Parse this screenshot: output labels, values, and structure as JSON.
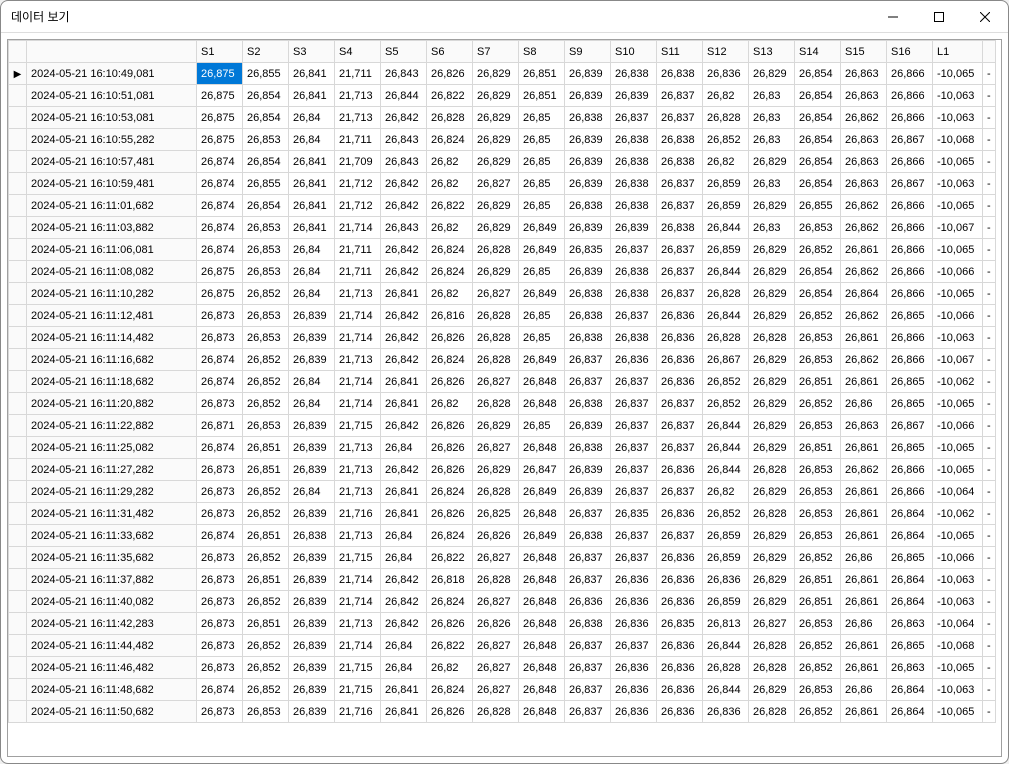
{
  "window": {
    "title": "데이터 보기"
  },
  "columns": [
    "S1",
    "S2",
    "S3",
    "S4",
    "S5",
    "S6",
    "S7",
    "S8",
    "S9",
    "S10",
    "S11",
    "S12",
    "S13",
    "S14",
    "S15",
    "S16",
    "L1"
  ],
  "selected": {
    "row": 0,
    "col": 0
  },
  "chart_data": {
    "type": "table",
    "columns": [
      "timestamp",
      "S1",
      "S2",
      "S3",
      "S4",
      "S5",
      "S6",
      "S7",
      "S8",
      "S9",
      "S10",
      "S11",
      "S12",
      "S13",
      "S14",
      "S15",
      "S16",
      "L1"
    ],
    "rows": [
      [
        "2024-05-21 16:10:49,081",
        "26,875",
        "26,855",
        "26,841",
        "21,711",
        "26,843",
        "26,826",
        "26,829",
        "26,851",
        "26,839",
        "26,838",
        "26,838",
        "26,836",
        "26,829",
        "26,854",
        "26,863",
        "26,866",
        "-10,065"
      ],
      [
        "2024-05-21 16:10:51,081",
        "26,875",
        "26,854",
        "26,841",
        "21,713",
        "26,844",
        "26,822",
        "26,829",
        "26,851",
        "26,839",
        "26,839",
        "26,837",
        "26,82",
        "26,83",
        "26,854",
        "26,863",
        "26,866",
        "-10,063"
      ],
      [
        "2024-05-21 16:10:53,081",
        "26,875",
        "26,854",
        "26,84",
        "21,713",
        "26,842",
        "26,828",
        "26,829",
        "26,85",
        "26,838",
        "26,837",
        "26,837",
        "26,828",
        "26,83",
        "26,854",
        "26,862",
        "26,866",
        "-10,063"
      ],
      [
        "2024-05-21 16:10:55,282",
        "26,875",
        "26,853",
        "26,84",
        "21,711",
        "26,843",
        "26,824",
        "26,829",
        "26,85",
        "26,839",
        "26,838",
        "26,838",
        "26,852",
        "26,83",
        "26,854",
        "26,863",
        "26,867",
        "-10,068"
      ],
      [
        "2024-05-21 16:10:57,481",
        "26,874",
        "26,854",
        "26,841",
        "21,709",
        "26,843",
        "26,82",
        "26,829",
        "26,85",
        "26,839",
        "26,838",
        "26,838",
        "26,82",
        "26,829",
        "26,854",
        "26,863",
        "26,866",
        "-10,065"
      ],
      [
        "2024-05-21 16:10:59,481",
        "26,874",
        "26,855",
        "26,841",
        "21,712",
        "26,842",
        "26,82",
        "26,827",
        "26,85",
        "26,839",
        "26,838",
        "26,837",
        "26,859",
        "26,83",
        "26,854",
        "26,863",
        "26,867",
        "-10,063"
      ],
      [
        "2024-05-21 16:11:01,682",
        "26,874",
        "26,854",
        "26,841",
        "21,712",
        "26,842",
        "26,822",
        "26,829",
        "26,85",
        "26,838",
        "26,838",
        "26,837",
        "26,859",
        "26,829",
        "26,855",
        "26,862",
        "26,866",
        "-10,065"
      ],
      [
        "2024-05-21 16:11:03,882",
        "26,874",
        "26,853",
        "26,841",
        "21,714",
        "26,843",
        "26,82",
        "26,829",
        "26,849",
        "26,839",
        "26,839",
        "26,838",
        "26,844",
        "26,83",
        "26,853",
        "26,862",
        "26,866",
        "-10,067"
      ],
      [
        "2024-05-21 16:11:06,081",
        "26,874",
        "26,853",
        "26,84",
        "21,711",
        "26,842",
        "26,824",
        "26,828",
        "26,849",
        "26,835",
        "26,837",
        "26,837",
        "26,859",
        "26,829",
        "26,852",
        "26,861",
        "26,866",
        "-10,065"
      ],
      [
        "2024-05-21 16:11:08,082",
        "26,875",
        "26,853",
        "26,84",
        "21,711",
        "26,842",
        "26,824",
        "26,829",
        "26,85",
        "26,839",
        "26,838",
        "26,837",
        "26,844",
        "26,829",
        "26,854",
        "26,862",
        "26,866",
        "-10,066"
      ],
      [
        "2024-05-21 16:11:10,282",
        "26,875",
        "26,852",
        "26,84",
        "21,713",
        "26,841",
        "26,82",
        "26,827",
        "26,849",
        "26,838",
        "26,838",
        "26,837",
        "26,828",
        "26,829",
        "26,854",
        "26,864",
        "26,866",
        "-10,065"
      ],
      [
        "2024-05-21 16:11:12,481",
        "26,873",
        "26,853",
        "26,839",
        "21,714",
        "26,842",
        "26,816",
        "26,828",
        "26,85",
        "26,838",
        "26,837",
        "26,836",
        "26,844",
        "26,829",
        "26,852",
        "26,862",
        "26,865",
        "-10,066"
      ],
      [
        "2024-05-21 16:11:14,482",
        "26,873",
        "26,853",
        "26,839",
        "21,714",
        "26,842",
        "26,826",
        "26,828",
        "26,85",
        "26,838",
        "26,838",
        "26,836",
        "26,828",
        "26,828",
        "26,853",
        "26,861",
        "26,866",
        "-10,063"
      ],
      [
        "2024-05-21 16:11:16,682",
        "26,874",
        "26,852",
        "26,839",
        "21,713",
        "26,842",
        "26,824",
        "26,828",
        "26,849",
        "26,837",
        "26,836",
        "26,836",
        "26,867",
        "26,829",
        "26,853",
        "26,862",
        "26,866",
        "-10,067"
      ],
      [
        "2024-05-21 16:11:18,682",
        "26,874",
        "26,852",
        "26,84",
        "21,714",
        "26,841",
        "26,826",
        "26,827",
        "26,848",
        "26,837",
        "26,837",
        "26,836",
        "26,852",
        "26,829",
        "26,851",
        "26,861",
        "26,865",
        "-10,062"
      ],
      [
        "2024-05-21 16:11:20,882",
        "26,873",
        "26,852",
        "26,84",
        "21,714",
        "26,841",
        "26,82",
        "26,828",
        "26,848",
        "26,838",
        "26,837",
        "26,837",
        "26,852",
        "26,829",
        "26,852",
        "26,86",
        "26,865",
        "-10,065"
      ],
      [
        "2024-05-21 16:11:22,882",
        "26,871",
        "26,853",
        "26,839",
        "21,715",
        "26,842",
        "26,826",
        "26,829",
        "26,85",
        "26,839",
        "26,837",
        "26,837",
        "26,844",
        "26,829",
        "26,853",
        "26,863",
        "26,867",
        "-10,066"
      ],
      [
        "2024-05-21 16:11:25,082",
        "26,874",
        "26,851",
        "26,839",
        "21,713",
        "26,84",
        "26,826",
        "26,827",
        "26,848",
        "26,838",
        "26,837",
        "26,837",
        "26,844",
        "26,829",
        "26,851",
        "26,861",
        "26,865",
        "-10,065"
      ],
      [
        "2024-05-21 16:11:27,282",
        "26,873",
        "26,851",
        "26,839",
        "21,713",
        "26,842",
        "26,826",
        "26,829",
        "26,847",
        "26,839",
        "26,837",
        "26,836",
        "26,844",
        "26,828",
        "26,853",
        "26,862",
        "26,866",
        "-10,065"
      ],
      [
        "2024-05-21 16:11:29,282",
        "26,873",
        "26,852",
        "26,84",
        "21,713",
        "26,841",
        "26,824",
        "26,828",
        "26,849",
        "26,839",
        "26,837",
        "26,837",
        "26,82",
        "26,829",
        "26,853",
        "26,861",
        "26,866",
        "-10,064"
      ],
      [
        "2024-05-21 16:11:31,482",
        "26,873",
        "26,852",
        "26,839",
        "21,716",
        "26,841",
        "26,826",
        "26,825",
        "26,848",
        "26,837",
        "26,835",
        "26,836",
        "26,852",
        "26,828",
        "26,853",
        "26,861",
        "26,864",
        "-10,062"
      ],
      [
        "2024-05-21 16:11:33,682",
        "26,874",
        "26,851",
        "26,838",
        "21,713",
        "26,84",
        "26,824",
        "26,826",
        "26,849",
        "26,838",
        "26,837",
        "26,837",
        "26,859",
        "26,829",
        "26,853",
        "26,861",
        "26,864",
        "-10,065"
      ],
      [
        "2024-05-21 16:11:35,682",
        "26,873",
        "26,852",
        "26,839",
        "21,715",
        "26,84",
        "26,822",
        "26,827",
        "26,848",
        "26,837",
        "26,837",
        "26,836",
        "26,859",
        "26,829",
        "26,852",
        "26,86",
        "26,865",
        "-10,066"
      ],
      [
        "2024-05-21 16:11:37,882",
        "26,873",
        "26,851",
        "26,839",
        "21,714",
        "26,842",
        "26,818",
        "26,828",
        "26,848",
        "26,837",
        "26,836",
        "26,836",
        "26,836",
        "26,829",
        "26,851",
        "26,861",
        "26,864",
        "-10,063"
      ],
      [
        "2024-05-21 16:11:40,082",
        "26,873",
        "26,852",
        "26,839",
        "21,714",
        "26,842",
        "26,824",
        "26,827",
        "26,848",
        "26,836",
        "26,836",
        "26,836",
        "26,859",
        "26,829",
        "26,851",
        "26,861",
        "26,864",
        "-10,063"
      ],
      [
        "2024-05-21 16:11:42,283",
        "26,873",
        "26,851",
        "26,839",
        "21,713",
        "26,842",
        "26,826",
        "26,826",
        "26,848",
        "26,838",
        "26,836",
        "26,835",
        "26,813",
        "26,827",
        "26,853",
        "26,86",
        "26,863",
        "-10,064"
      ],
      [
        "2024-05-21 16:11:44,482",
        "26,873",
        "26,852",
        "26,839",
        "21,714",
        "26,84",
        "26,822",
        "26,827",
        "26,848",
        "26,837",
        "26,837",
        "26,836",
        "26,844",
        "26,828",
        "26,852",
        "26,861",
        "26,865",
        "-10,068"
      ],
      [
        "2024-05-21 16:11:46,482",
        "26,873",
        "26,852",
        "26,839",
        "21,715",
        "26,84",
        "26,82",
        "26,827",
        "26,848",
        "26,837",
        "26,836",
        "26,836",
        "26,828",
        "26,828",
        "26,852",
        "26,861",
        "26,863",
        "-10,065"
      ],
      [
        "2024-05-21 16:11:48,682",
        "26,874",
        "26,852",
        "26,839",
        "21,715",
        "26,841",
        "26,824",
        "26,827",
        "26,848",
        "26,837",
        "26,836",
        "26,836",
        "26,844",
        "26,829",
        "26,853",
        "26,86",
        "26,864",
        "-10,063"
      ],
      [
        "2024-05-21 16:11:50,682",
        "26,873",
        "26,853",
        "26,839",
        "21,716",
        "26,841",
        "26,826",
        "26,828",
        "26,848",
        "26,837",
        "26,836",
        "26,836",
        "26,836",
        "26,828",
        "26,852",
        "26,861",
        "26,864",
        "-10,065"
      ]
    ]
  }
}
